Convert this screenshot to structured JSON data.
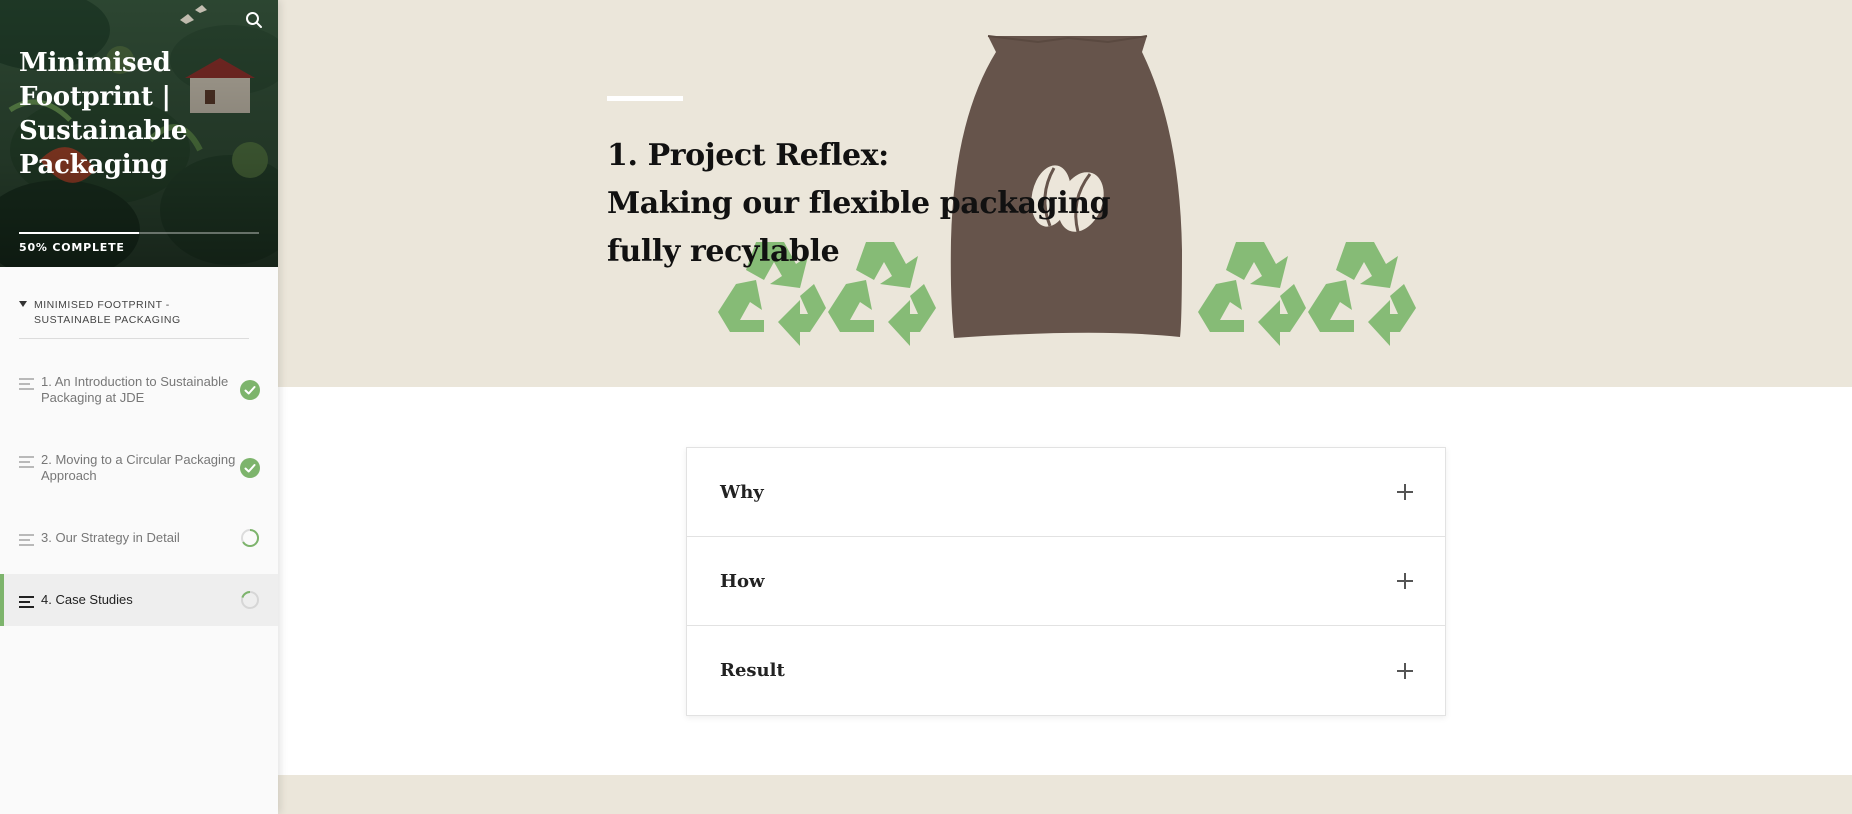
{
  "sidebar": {
    "course_title": "Minimised Footprint | Sustainable Packaging",
    "progress": {
      "percent": 50,
      "label": "50% COMPLETE"
    },
    "section": {
      "label": "MINIMISED FOOTPRINT - SUSTAINABLE PACKAGING",
      "expanded": true
    },
    "lessons": [
      {
        "label": "1. An Introduction to Sustainable Packaging at JDE",
        "status": "complete"
      },
      {
        "label": "2. Moving to a Circular Packaging Approach",
        "status": "complete"
      },
      {
        "label": "3. Our Strategy in Detail",
        "status": "in-progress"
      },
      {
        "label": "4. Case Studies",
        "status": "in-progress",
        "active": true
      }
    ]
  },
  "hero": {
    "title_line1": "1. Project Reflex:",
    "title_line2": "Making our flexible packaging",
    "title_line3": "fully recylable"
  },
  "accordion": {
    "items": [
      {
        "title": "Why"
      },
      {
        "title": "How"
      },
      {
        "title": "Result"
      }
    ]
  },
  "colors": {
    "accent_green": "#7db46c",
    "hero_bg": "#ebe6da",
    "bag_brown": "#66544b",
    "recycle_green": "#86bb76"
  },
  "icons": [
    "search-icon",
    "check-icon",
    "progress-ring-icon",
    "recycle-icon",
    "coffee-bean-icon",
    "plus-icon"
  ]
}
